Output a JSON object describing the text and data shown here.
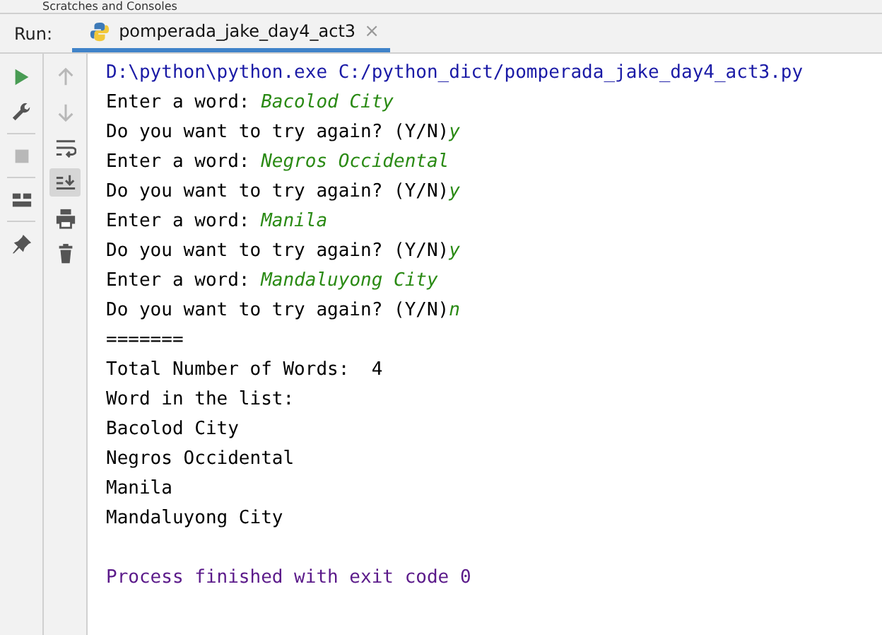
{
  "top_strip": {
    "label": "Scratches and Consoles"
  },
  "run_bar": {
    "label": "Run:",
    "tab": {
      "title": "pomperada_jake_day4_act3",
      "close": "×",
      "selected": true
    }
  },
  "left_toolbar": [
    {
      "kind": "run",
      "disabled": false
    },
    {
      "kind": "wrench",
      "disabled": false
    },
    {
      "kind": "stop",
      "disabled": true
    },
    {
      "kind": "layout",
      "disabled": false
    },
    {
      "kind": "pin",
      "disabled": false
    }
  ],
  "console_toolbar": [
    {
      "kind": "up",
      "disabled": true,
      "selected": false
    },
    {
      "kind": "down",
      "disabled": true,
      "selected": false
    },
    {
      "kind": "wrap",
      "disabled": false,
      "selected": false
    },
    {
      "kind": "scroll-end",
      "disabled": false,
      "selected": true
    },
    {
      "kind": "print",
      "disabled": false,
      "selected": false
    },
    {
      "kind": "trash",
      "disabled": false,
      "selected": false
    }
  ],
  "console": [
    [
      {
        "kind": "cmd",
        "text": "D:\\python\\python.exe C:/python_dict/pomperada_jake_day4_act3.py"
      }
    ],
    [
      {
        "kind": "out",
        "text": "Enter a word: "
      },
      {
        "kind": "in",
        "text": "Bacolod City"
      }
    ],
    [
      {
        "kind": "out",
        "text": "Do you want to try again? (Y/N)"
      },
      {
        "kind": "in",
        "text": "y"
      }
    ],
    [
      {
        "kind": "out",
        "text": "Enter a word: "
      },
      {
        "kind": "in",
        "text": "Negros Occidental"
      }
    ],
    [
      {
        "kind": "out",
        "text": "Do you want to try again? (Y/N)"
      },
      {
        "kind": "in",
        "text": "y"
      }
    ],
    [
      {
        "kind": "out",
        "text": "Enter a word: "
      },
      {
        "kind": "in",
        "text": "Manila"
      }
    ],
    [
      {
        "kind": "out",
        "text": "Do you want to try again? (Y/N)"
      },
      {
        "kind": "in",
        "text": "y"
      }
    ],
    [
      {
        "kind": "out",
        "text": "Enter a word: "
      },
      {
        "kind": "in",
        "text": "Mandaluyong City"
      }
    ],
    [
      {
        "kind": "out",
        "text": "Do you want to try again? (Y/N)"
      },
      {
        "kind": "in",
        "text": "n"
      }
    ],
    [
      {
        "kind": "out",
        "text": "======="
      }
    ],
    [
      {
        "kind": "out",
        "text": "Total Number of Words:  4"
      }
    ],
    [
      {
        "kind": "out",
        "text": "Word in the list:"
      }
    ],
    [
      {
        "kind": "out",
        "text": "Bacolod City"
      }
    ],
    [
      {
        "kind": "out",
        "text": "Negros Occidental"
      }
    ],
    [
      {
        "kind": "out",
        "text": "Manila"
      }
    ],
    [
      {
        "kind": "out",
        "text": "Mandaluyong City"
      }
    ],
    [
      {
        "kind": "sys",
        "text": "Process finished with exit code 0"
      }
    ]
  ]
}
